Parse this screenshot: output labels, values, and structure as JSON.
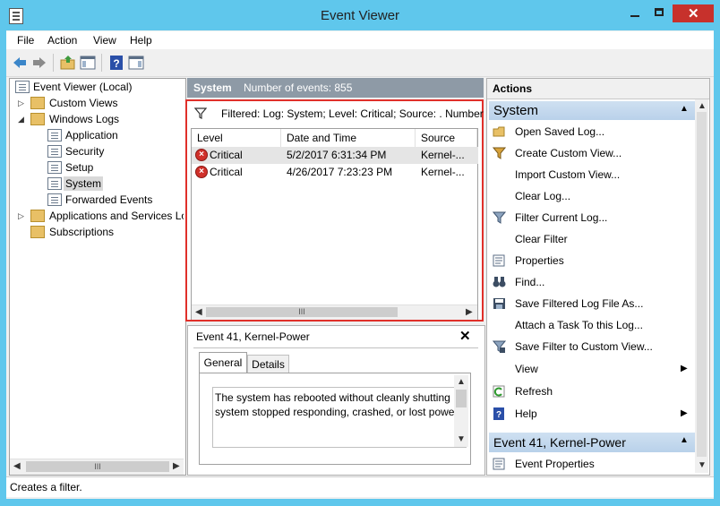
{
  "window": {
    "title": "Event Viewer"
  },
  "menu": [
    "File",
    "Action",
    "View",
    "Help"
  ],
  "tree": {
    "root": "Event Viewer (Local)",
    "custom_views": "Custom Views",
    "windows_logs": "Windows Logs",
    "logs": [
      "Application",
      "Security",
      "Setup",
      "System",
      "Forwarded Events"
    ],
    "apps_services": "Applications and Services Lo",
    "subscriptions": "Subscriptions"
  },
  "center": {
    "header_title": "System",
    "header_count": "Number of events: 855",
    "filter_text": "Filtered: Log: System; Level: Critical; Source: . Number",
    "columns": [
      "Level",
      "Date and Time",
      "Source"
    ],
    "events": [
      {
        "level": "Critical",
        "datetime": "5/2/2017 6:31:34 PM",
        "source": "Kernel-..."
      },
      {
        "level": "Critical",
        "datetime": "4/26/2017 7:23:23 PM",
        "source": "Kernel-..."
      }
    ]
  },
  "detail": {
    "title": "Event 41, Kernel-Power",
    "tabs": [
      "General",
      "Details"
    ],
    "text_line1": "The system has rebooted without cleanly shutting",
    "text_line2": "system stopped responding, crashed, or lost power"
  },
  "actions": {
    "header": "Actions",
    "section1": "System",
    "items": [
      {
        "label": "Open Saved Log...",
        "icon": "open-folder-icon"
      },
      {
        "label": "Create Custom View...",
        "icon": "filter-icon"
      },
      {
        "label": "Import Custom View...",
        "icon": ""
      },
      {
        "label": "Clear Log...",
        "icon": ""
      },
      {
        "label": "Filter Current Log...",
        "icon": "filter-icon"
      },
      {
        "label": "Clear Filter",
        "icon": ""
      },
      {
        "label": "Properties",
        "icon": "properties-icon"
      },
      {
        "label": "Find...",
        "icon": "binoculars-icon"
      },
      {
        "label": "Save Filtered Log File As...",
        "icon": "save-icon"
      },
      {
        "label": "Attach a Task To this Log...",
        "icon": ""
      },
      {
        "label": "Save Filter to Custom View...",
        "icon": "filter-save-icon"
      },
      {
        "label": "View",
        "icon": ""
      },
      {
        "label": "Refresh",
        "icon": "refresh-icon"
      },
      {
        "label": "Help",
        "icon": "help-icon"
      }
    ],
    "section2": "Event 41, Kernel-Power",
    "section2_items": [
      "Event Properties"
    ]
  },
  "status": {
    "text": "Creates a filter."
  },
  "scroll_glyph": "III",
  "colors": {
    "highlight": "#e0302a",
    "accent": "#5fc7ec"
  }
}
